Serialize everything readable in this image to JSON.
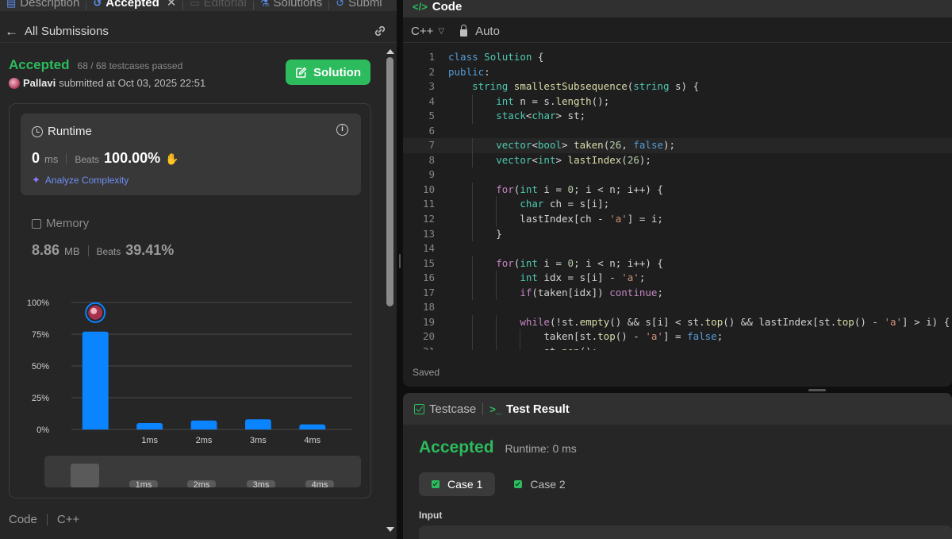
{
  "left_tabs": [
    {
      "label": "Description",
      "state": "normal"
    },
    {
      "label": "Accepted",
      "state": "active"
    },
    {
      "label": "Editorial",
      "state": "dim"
    },
    {
      "label": "Solutions",
      "state": "normal"
    },
    {
      "label": "Submi",
      "state": "normal"
    }
  ],
  "submission": {
    "back_label": "All Submissions",
    "status": "Accepted",
    "testcases": "68 / 68 testcases passed",
    "user": "Pallavi",
    "submitted_text": "submitted at Oct 03, 2025 22:51",
    "solution_button": "Solution"
  },
  "runtime": {
    "title": "Runtime",
    "value": "0",
    "unit": "ms",
    "beats_label": "Beats",
    "beats": "100.00%",
    "analyze": "Analyze Complexity"
  },
  "memory": {
    "title": "Memory",
    "value": "8.86",
    "unit": "MB",
    "beats_label": "Beats",
    "beats": "39.41%"
  },
  "chart_data": {
    "type": "bar",
    "categories": [
      "0ms",
      "1ms",
      "2ms",
      "3ms",
      "4ms"
    ],
    "x_tick_labels": [
      "",
      "1ms",
      "2ms",
      "3ms",
      "4ms"
    ],
    "values": [
      77,
      5,
      7,
      8,
      4
    ],
    "ylim": [
      0,
      100
    ],
    "y_tick_labels": [
      "100%",
      "75%",
      "50%",
      "25%",
      "0%"
    ],
    "y_ticks": [
      100,
      75,
      50,
      25,
      0
    ],
    "highlight_index": 0,
    "bar_color": "#0a84ff",
    "grid": true,
    "mini_labels": [
      "1ms",
      "2ms",
      "3ms",
      "4ms"
    ]
  },
  "footer": {
    "code": "Code",
    "lang": "C++"
  },
  "code_panel": {
    "title": "Code",
    "language": "C++",
    "mode": "Auto",
    "saved": "Saved",
    "highlighted_line": 7,
    "lines": [
      "class Solution {",
      "public:",
      "    string smallestSubsequence(string s) {",
      "        int n = s.length();",
      "        stack<char> st;",
      "",
      "        vector<bool> taken(26, false);",
      "        vector<int> lastIndex(26);",
      "",
      "        for(int i = 0; i < n; i++) {",
      "            char ch = s[i];",
      "            lastIndex[ch - 'a'] = i;",
      "        }",
      "",
      "        for(int i = 0; i < n; i++) {",
      "            int idx = s[i] - 'a';",
      "            if(taken[idx]) continue;",
      "",
      "            while(!st.empty() && s[i] < st.top() && lastIndex[st.top() - 'a'] > i) {",
      "                taken[st.top() - 'a'] = false;",
      "                st.pop();"
    ]
  },
  "test_panel": {
    "testcase_tab": "Testcase",
    "result_tab": "Test Result",
    "status": "Accepted",
    "runtime": "Runtime: 0 ms",
    "cases": [
      "Case 1",
      "Case 2"
    ],
    "input_label": "Input"
  },
  "colors": {
    "accent_green": "#2cbb5d",
    "bar_blue": "#0a84ff",
    "panel_bg": "#262626",
    "editor_bg": "#1e1e1e"
  }
}
